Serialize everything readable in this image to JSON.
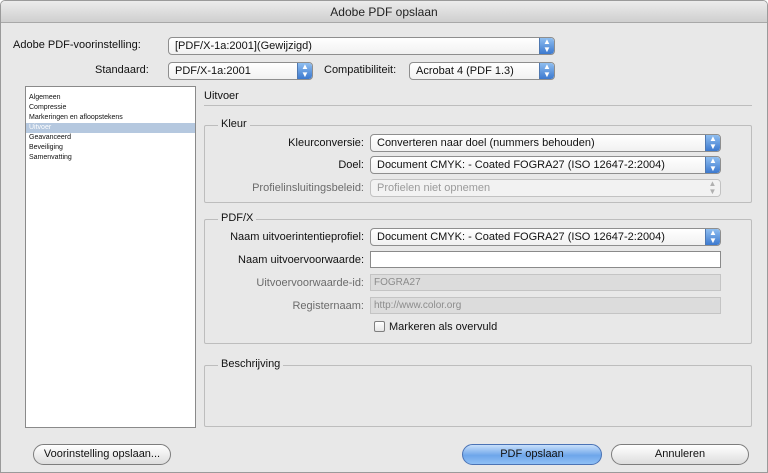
{
  "window": {
    "title": "Adobe PDF opslaan"
  },
  "header": {
    "preset_label": "Adobe PDF-voorinstelling:",
    "preset_value": "[PDF/X-1a:2001](Gewijzigd)",
    "standard_label": "Standaard:",
    "standard_value": "PDF/X-1a:2001",
    "compat_label": "Compatibiliteit:",
    "compat_value": "Acrobat 4 (PDF 1.3)"
  },
  "sidebar": {
    "items": [
      {
        "label": "Algemeen"
      },
      {
        "label": "Compressie"
      },
      {
        "label": "Markeringen en afloopstekens"
      },
      {
        "label": "Uitvoer"
      },
      {
        "label": "Geavanceerd"
      },
      {
        "label": "Beveiliging"
      },
      {
        "label": "Samenvatting"
      }
    ],
    "selected_index": 3
  },
  "panel": {
    "title": "Uitvoer",
    "kleur": {
      "title": "Kleur",
      "conversion_label": "Kleurconversie:",
      "conversion_value": "Converteren naar doel (nummers behouden)",
      "target_label": "Doel:",
      "target_value": "Document CMYK:  - Coated FOGRA27 (ISO 12647-2:2004)",
      "profile_label": "Profielinsluitingsbeleid:",
      "profile_value": "Profielen niet opnemen"
    },
    "pdfx": {
      "title": "PDF/X",
      "intent_label": "Naam uitvoerintentieprofiel:",
      "intent_value": "Document CMYK:  - Coated FOGRA27 (ISO 12647-2:2004)",
      "condition_name_label": "Naam uitvoervoorwaarde:",
      "condition_name_value": "",
      "condition_id_label": "Uitvoervoorwaarde-id:",
      "condition_id_value": "FOGRA27",
      "registry_label": "Registernaam:",
      "registry_value": "http://www.color.org",
      "trapped_label": "Markeren als overvuld",
      "trapped_checked": false
    },
    "description": {
      "title": "Beschrijving"
    }
  },
  "footer": {
    "save_preset_label": "Voorinstelling opslaan...",
    "save_pdf_label": "PDF opslaan",
    "cancel_label": "Annuleren"
  }
}
